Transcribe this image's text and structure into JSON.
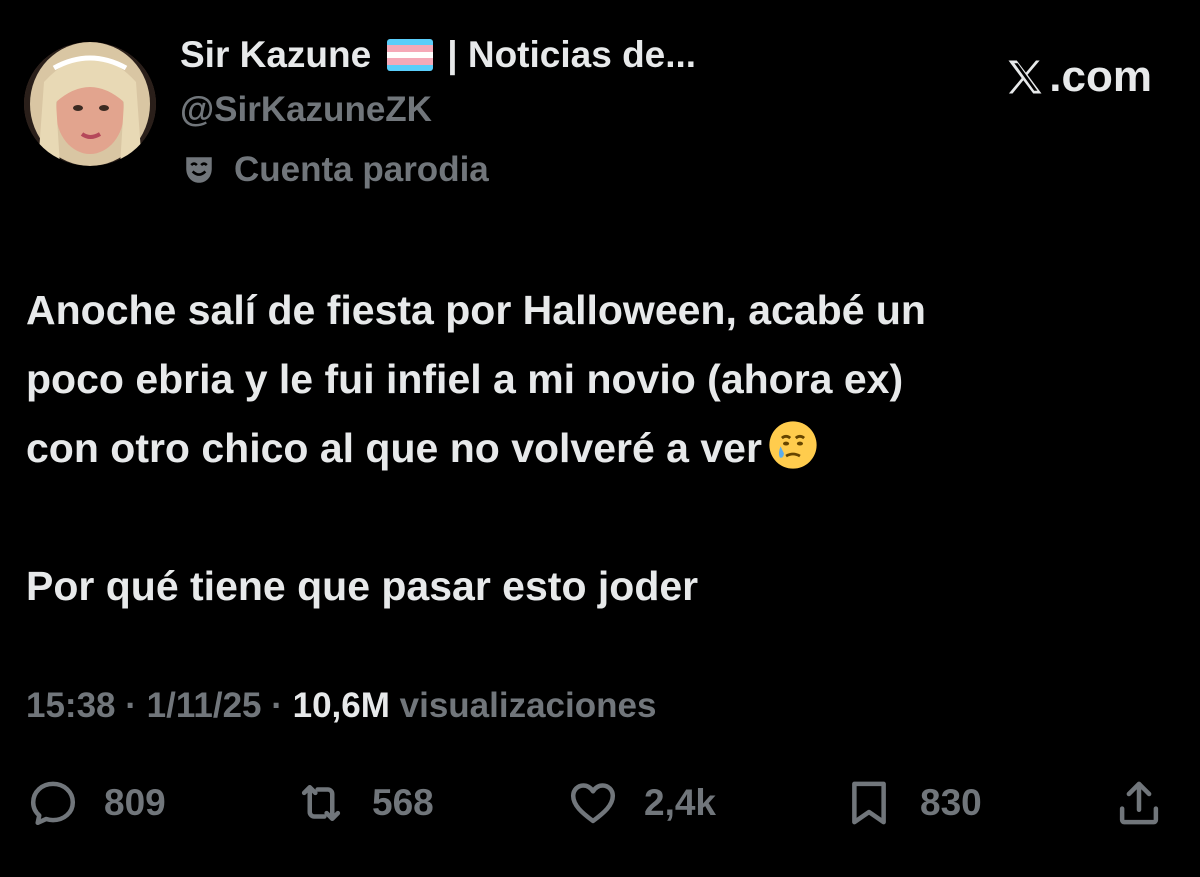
{
  "author": {
    "display_name": "Sir Kazune",
    "display_name_suffix": "| Noticias de...",
    "handle": "@SirKazuneZK",
    "parody_label": "Cuenta parodia",
    "flag_colors": [
      "#5BCEFA",
      "#F5A9B8",
      "#FFFFFF",
      "#F5A9B8",
      "#5BCEFA"
    ]
  },
  "brand": {
    "label": ".com",
    "icon": "x-logo-icon"
  },
  "tweet": {
    "line1": "Anoche salí de fiesta por Halloween, acabé un",
    "line2": "poco ebria y le fui infiel a mi novio (ahora ex)",
    "line3": "con otro chico al que no volveré a ver",
    "line3_emoji": "face-holding-back-tears",
    "line4": "Por qué tiene que pasar esto joder"
  },
  "meta": {
    "time": "15:38",
    "date": "1/11/25",
    "views_count": "10,6M",
    "views_label": "visualizaciones",
    "separator": "·"
  },
  "actions": {
    "replies": "809",
    "reposts": "568",
    "likes": "2,4k",
    "bookmarks": "830"
  },
  "colors": {
    "background": "#000000",
    "text_primary": "#e7e9ea",
    "text_secondary": "#71767b"
  }
}
